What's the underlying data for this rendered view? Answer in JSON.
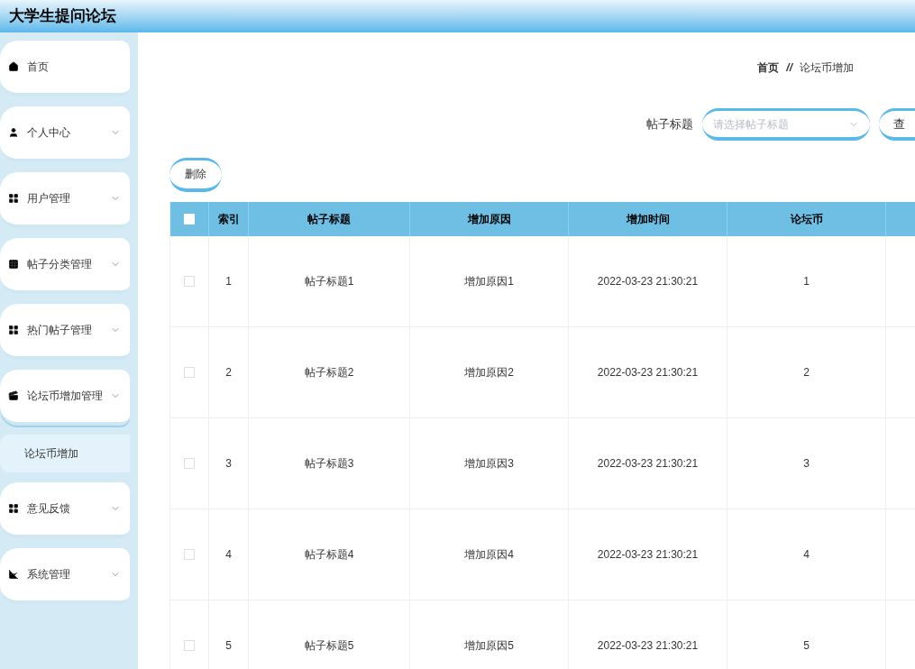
{
  "header": {
    "title": "大学生提问论坛"
  },
  "sidebar": {
    "items": [
      {
        "label": "首页",
        "kind": "link"
      },
      {
        "label": "个人中心",
        "kind": "submenu",
        "expanded": false
      },
      {
        "label": "用户管理",
        "kind": "submenu",
        "expanded": false
      },
      {
        "label": "帖子分类管理",
        "kind": "submenu",
        "expanded": false
      },
      {
        "label": "热门帖子管理",
        "kind": "submenu",
        "expanded": false
      },
      {
        "label": "论坛币增加管理",
        "kind": "submenu",
        "expanded": true,
        "children": [
          {
            "label": "论坛币增加",
            "selected": true
          }
        ]
      },
      {
        "label": "意见反馈",
        "kind": "submenu",
        "expanded": false
      },
      {
        "label": "系统管理",
        "kind": "submenu",
        "expanded": false
      }
    ]
  },
  "breadcrumb": [
    "首页",
    "论坛币增加"
  ],
  "breadcrumb_separator": "//",
  "search": {
    "label": "帖子标题",
    "placeholder": "请选择帖子标题",
    "button": "查"
  },
  "delete_button": "删除",
  "table": {
    "columns": [
      "索引",
      "帖子标题",
      "增加原因",
      "增加时间",
      "论坛币"
    ],
    "all_checked": false,
    "rows": [
      {
        "checked": false,
        "cells": [
          "1",
          "帖子标题1",
          "增加原因1",
          "2022-03-23 21:30:21",
          "1"
        ]
      },
      {
        "checked": false,
        "cells": [
          "2",
          "帖子标题2",
          "增加原因2",
          "2022-03-23 21:30:21",
          "2"
        ]
      },
      {
        "checked": false,
        "cells": [
          "3",
          "帖子标题3",
          "增加原因3",
          "2022-03-23 21:30:21",
          "3"
        ]
      },
      {
        "checked": false,
        "cells": [
          "4",
          "帖子标题4",
          "增加原因4",
          "2022-03-23 21:30:21",
          "4"
        ]
      },
      {
        "checked": false,
        "cells": [
          "5",
          "帖子标题5",
          "增加原因5",
          "2022-03-23 21:30:21",
          "5"
        ]
      }
    ]
  }
}
